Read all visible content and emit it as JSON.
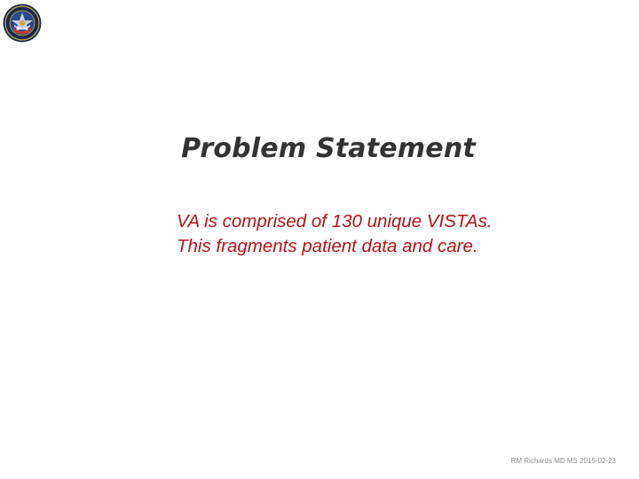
{
  "slide": {
    "title": "Problem Statement",
    "body_lines": [
      "VA is comprised of 130 unique VISTAs.",
      "This fragments patient data and care."
    ],
    "footer": "RM Richards MD MS  2015-02-23",
    "logo": {
      "icon": "department-seal-icon"
    }
  },
  "colors": {
    "title": "#333333",
    "body": "#b5131b",
    "footer": "#8a8a8a",
    "seal_outer": "#1c2b4d",
    "seal_ring": "#c9a94a",
    "seal_inner": "#2d4a8a"
  }
}
